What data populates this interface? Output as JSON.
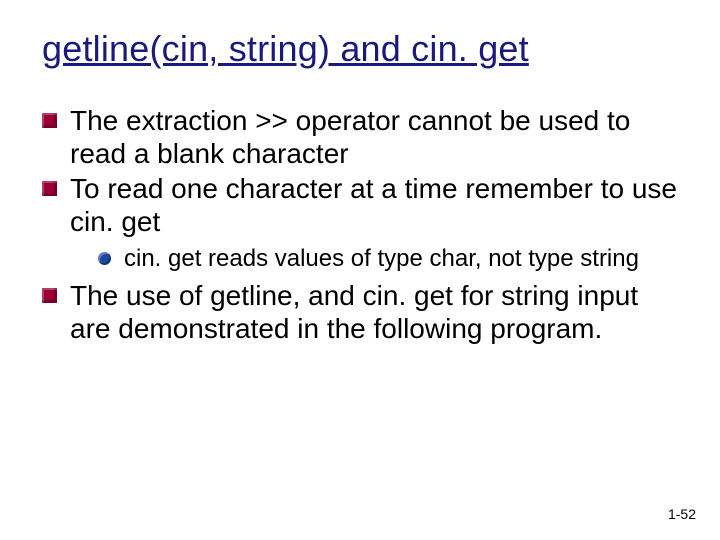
{
  "title": "getline(cin, string) and cin. get",
  "bullets": [
    {
      "text": "The extraction >> operator cannot be used to read a blank character"
    },
    {
      "text": "To read one character at a time remember to use cin. get",
      "sub": [
        {
          "text": "cin. get reads values of type char, not type string"
        }
      ]
    },
    {
      "text": "The use of getline, and cin. get for string input are demonstrated in the following program."
    }
  ],
  "footer": "1-52"
}
